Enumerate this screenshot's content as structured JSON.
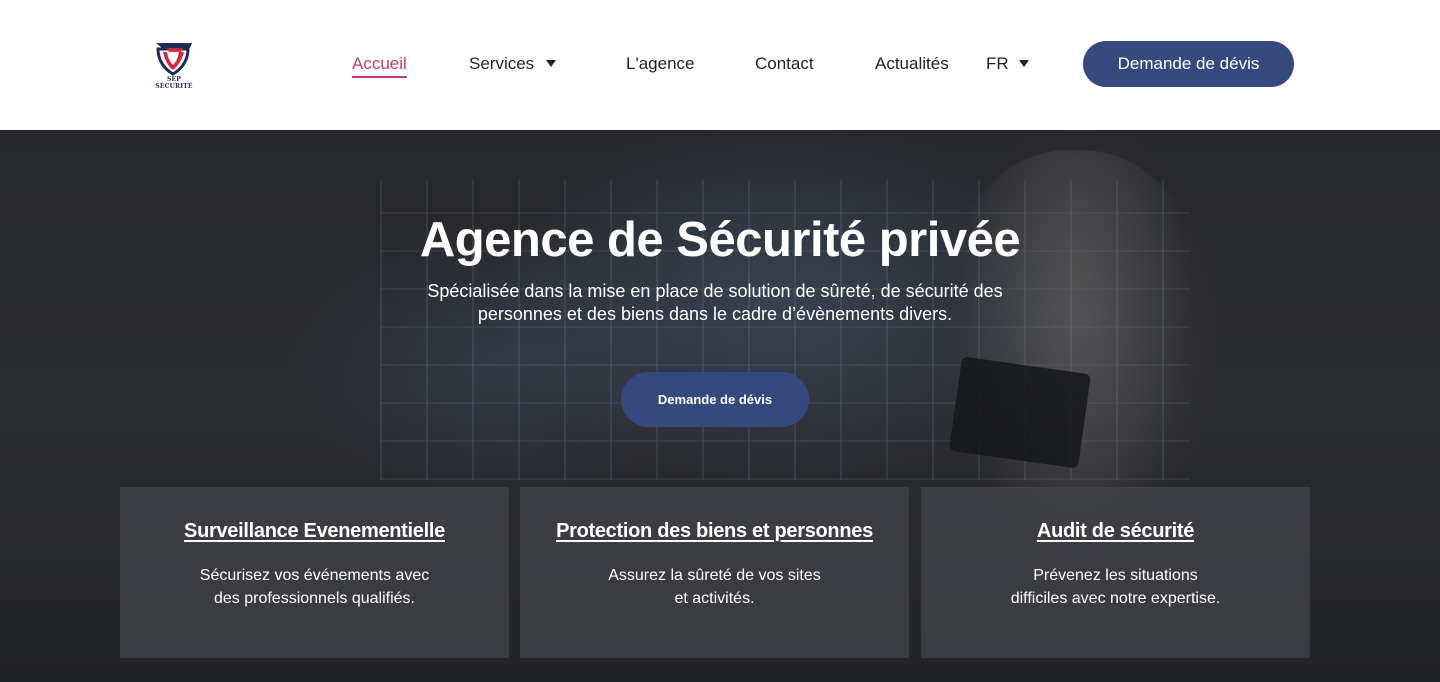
{
  "header": {
    "logo_text": "SEP SÉCURITÉ",
    "nav": [
      {
        "label": "Accueil",
        "active": true
      },
      {
        "label": "Services",
        "has_dropdown": true
      },
      {
        "label": "L'agence"
      },
      {
        "label": "Contact"
      },
      {
        "label": "Actualités"
      }
    ],
    "language": "FR",
    "cta_label": "Demande de dévis"
  },
  "hero": {
    "title": "Agence de Sécurité privée",
    "subtitle_line1": "Spécialisée dans la mise en place de solution de sûreté, de sécurité des",
    "subtitle_line2": "personnes et des biens dans le cadre d’évènements divers.",
    "cta_label": "Demande de dévis"
  },
  "cards": [
    {
      "title": "Surveillance Evenementielle",
      "line1": "Sécurisez vos événements avec",
      "line2": "des professionnels qualifiés."
    },
    {
      "title": "Protection des biens et personnes",
      "line1": "Assurez la sûreté de vos sites",
      "line2": "et activités."
    },
    {
      "title": "Audit de sécurité",
      "line1": "Prévenez les situations",
      "line2": "difficiles avec notre expertise."
    }
  ],
  "colors": {
    "accent": "#35497e",
    "active_nav": "#c23a6e",
    "logo_red": "#d8283b",
    "logo_navy": "#1f2a55"
  }
}
